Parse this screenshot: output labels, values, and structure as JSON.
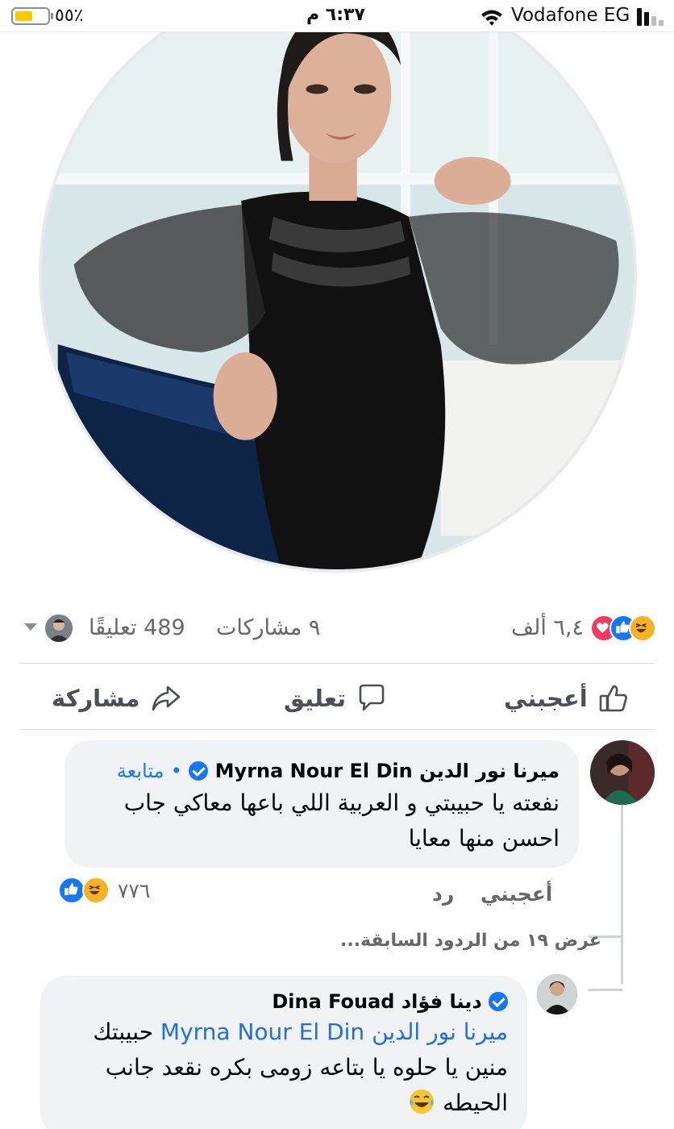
{
  "status_bar": {
    "battery_percent": "٪٥٥",
    "battery_level": 0.55,
    "time": "٦:٣٧ م",
    "carrier": "Vodafone EG"
  },
  "post": {
    "reactions_count": "٦,٤ ألف",
    "reaction_icons": [
      "haha-icon",
      "like-icon",
      "love-icon"
    ],
    "shares": "٩ مشاركات",
    "comments": "489 تعليقًا"
  },
  "actions": {
    "like": "أعجبني",
    "comment": "تعليق",
    "share": "مشاركة"
  },
  "comment1": {
    "author_ar": "ميرنا نور الدين",
    "author_en": "Myrna Nour El Din",
    "follow": "متابعة",
    "separator": "•",
    "text_line1": "نفعته يا حبيبتي و العربية اللي باعها معاكي جاب",
    "text_line2": "احسن منها معايا",
    "like_label": "أعجبني",
    "reply_label": "رد",
    "reactions_count": "٧٧٦"
  },
  "view_previous": "عرض ١٩ من الردود السابقة...",
  "comment2": {
    "author_ar": "دينا فؤاد",
    "author_en": "Dina Fouad",
    "mention": "ميرنا نور الدين Myrna Nour El Din",
    "text_line1_rest": "حبيبتك",
    "text_line2": "منين يا حلوه يا بتاعه زومى بكره نقعد جانب",
    "text_line3": "الحيطه"
  },
  "colors": {
    "accent": "#1877f2",
    "bubble": "#f0f2f5",
    "secondary_text": "#65676b"
  }
}
